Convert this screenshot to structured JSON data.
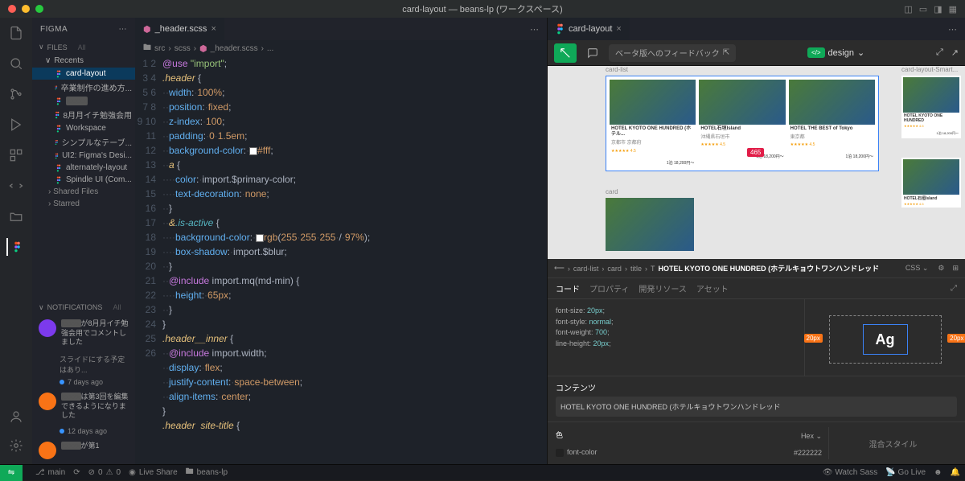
{
  "titlebar": {
    "title": "card-layout — beans-lp (ワークスペース)"
  },
  "sidebar": {
    "title": "FIGMA",
    "sections": {
      "files": "FILES",
      "all1": "All",
      "recents": "Recents",
      "items": [
        "card-layout",
        "卒業制作の進め方...",
        "",
        "8月月イチ勉強会用",
        "Workspace",
        "シンプルなテーブ...",
        "UI2: Figma's Desi...",
        "alternately-layout",
        "Spindle UI (Com..."
      ],
      "shared": "Shared Files",
      "starred": "Starred",
      "notifications": "NOTIFICATIONS",
      "all2": "All"
    },
    "notifs": [
      {
        "body_pre": "",
        "body": "が8月月イチ勉強会用でコメントしました",
        "meta": "スライドにする予定はあり...",
        "time": "7 days ago",
        "color": "#7c3aed"
      },
      {
        "body_pre": "",
        "body": "は第3回を編集できるようになりました",
        "meta": "",
        "time": "12 days ago",
        "color": "#f97316"
      },
      {
        "body_pre": "",
        "body": "が第1",
        "meta": "",
        "time": "",
        "color": "#f97316"
      }
    ]
  },
  "editor": {
    "tab": "_header.scss",
    "crumbs": [
      "src",
      "scss",
      "_header.scss",
      "..."
    ],
    "lines": [
      {
        "n": 1,
        "html": "<span class='k-use'>@use</span> <span class='k-str'>\"import\"</span><span class='k-pun'>;</span>"
      },
      {
        "n": 2,
        "html": "<span class='k-sel'>.header</span> <span class='k-pun'>{</span>"
      },
      {
        "n": 3,
        "html": "<span class='k-dot'>··</span><span class='k-prop'>width</span><span class='k-pun'>:</span><span class='k-dot'>·</span><span class='k-num'>100%</span><span class='k-pun'>;</span>"
      },
      {
        "n": 4,
        "html": "<span class='k-dot'>··</span><span class='k-prop'>position</span><span class='k-pun'>:</span><span class='k-dot'>·</span><span class='k-val'>fixed</span><span class='k-pun'>;</span>"
      },
      {
        "n": 5,
        "html": "<span class='k-dot'>··</span><span class='k-prop'>z-index</span><span class='k-pun'>:</span><span class='k-dot'>·</span><span class='k-num'>100</span><span class='k-pun'>;</span>"
      },
      {
        "n": 6,
        "html": "<span class='k-dot'>··</span><span class='k-prop'>padding</span><span class='k-pun'>:</span><span class='k-dot'>·</span><span class='k-num'>0</span><span class='k-dot'>·</span><span class='k-num'>1.5em</span><span class='k-pun'>;</span>"
      },
      {
        "n": 7,
        "html": "<span class='k-dot'>··</span><span class='k-prop'>background-color</span><span class='k-pun'>:</span><span class='k-dot'>·</span><span class='k-box'></span><span class='k-num'>#fff</span><span class='k-pun'>;</span>"
      },
      {
        "n": 8,
        "html": "<span class='k-dot'>··</span><span class='k-sel'>a</span> <span class='k-pun'>{</span>"
      },
      {
        "n": 9,
        "html": "<span class='k-dot'>····</span><span class='k-prop'>color</span><span class='k-pun'>:</span><span class='k-dot'>·</span>import.$primary-color<span class='k-pun'>;</span>"
      },
      {
        "n": 10,
        "html": "<span class='k-dot'>····</span><span class='k-prop'>text-decoration</span><span class='k-pun'>:</span><span class='k-dot'>·</span><span class='k-val'>none</span><span class='k-pun'>;</span>"
      },
      {
        "n": 11,
        "html": "<span class='k-dot'>··</span><span class='k-pun'>}</span>"
      },
      {
        "n": 12,
        "html": "<span class='k-dot'>··</span><span class='k-sel'>&amp;</span><span class='k-pse'>.is-active</span> <span class='k-pun'>{</span>"
      },
      {
        "n": 13,
        "html": "<span class='k-dot'>····</span><span class='k-prop'>background-color</span><span class='k-pun'>:</span><span class='k-dot'>·</span><span class='k-box'></span><span class='k-val'>rgb</span><span class='k-pun'>(</span><span class='k-num'>255</span><span class='k-dot'>·</span><span class='k-num'>255</span><span class='k-dot'>·</span><span class='k-num'>255</span><span class='k-dot'>·</span><span class='k-pun'>/</span><span class='k-dot'>·</span><span class='k-num'>97%</span><span class='k-pun'>);</span>"
      },
      {
        "n": 14,
        "html": "<span class='k-dot'>····</span><span class='k-prop'>box-shadow</span><span class='k-pun'>:</span><span class='k-dot'>·</span>import.$blur<span class='k-pun'>;</span>"
      },
      {
        "n": 15,
        "html": "<span class='k-dot'>··</span><span class='k-pun'>}</span>"
      },
      {
        "n": 16,
        "html": "<span class='k-dot'>··</span><span class='k-use'>@include</span> import.mq(md-min) <span class='k-pun'>{</span>"
      },
      {
        "n": 17,
        "html": "<span class='k-dot'>····</span><span class='k-prop'>height</span><span class='k-pun'>:</span><span class='k-dot'>·</span><span class='k-num'>65px</span><span class='k-pun'>;</span>"
      },
      {
        "n": 18,
        "html": "<span class='k-dot'>··</span><span class='k-pun'>}</span>"
      },
      {
        "n": 19,
        "html": "<span class='k-pun'>}</span>"
      },
      {
        "n": 20,
        "html": "<span class='k-sel'>.header__inner</span> <span class='k-pun'>{</span>"
      },
      {
        "n": 21,
        "html": "<span class='k-dot'>··</span><span class='k-use'>@include</span> import.width<span class='k-pun'>;</span>"
      },
      {
        "n": 22,
        "html": "<span class='k-dot'>··</span><span class='k-prop'>display</span><span class='k-pun'>:</span><span class='k-dot'>·</span><span class='k-val'>flex</span><span class='k-pun'>;</span>"
      },
      {
        "n": 23,
        "html": "<span class='k-dot'>··</span><span class='k-prop'>justify-content</span><span class='k-pun'>:</span><span class='k-dot'>·</span><span class='k-val'>space-between</span><span class='k-pun'>;</span>"
      },
      {
        "n": 24,
        "html": "<span class='k-dot'>··</span><span class='k-prop'>align-items</span><span class='k-pun'>:</span><span class='k-dot'>·</span><span class='k-val'>center</span><span class='k-pun'>;</span>"
      },
      {
        "n": 25,
        "html": "<span class='k-pun'>}</span>"
      },
      {
        "n": 26,
        "html": "<span class='k-sel'>.header</span>  <span class='k-sel'>site-title</span> <span class='k-pun'>{</span>"
      }
    ]
  },
  "figma": {
    "tab": "card-layout",
    "feedback": "ベータ版へのフィードバック",
    "design": "design",
    "frame_labels": {
      "list": "card-list",
      "card": "card",
      "smart": "card-layout-Smart..."
    },
    "cards": [
      {
        "title": "HOTEL KYOTO ONE HUNDRED (ホテル...",
        "sub": "京都市 京都府",
        "price": "1泊 18,200円〜"
      },
      {
        "title": "HOTEL石垣Island",
        "sub": "沖縄県石垣市",
        "price": "1泊 18,200円〜"
      },
      {
        "title": "HOTEL THE BEST of Tokyo",
        "sub": "東京都",
        "price": "1泊 18,200円〜"
      }
    ],
    "sel_badge": "465",
    "inspector": {
      "crumbs": [
        "card-list",
        "card",
        "title"
      ],
      "title": "HOTEL KYOTO ONE HUNDRED (ホテルキョウトワンハンドレッド",
      "css_label": "CSS",
      "tabs": [
        "コード",
        "プロパティ",
        "開発リソース",
        "アセット"
      ],
      "css": [
        "font-size: 20px;",
        "font-style: normal;",
        "font-weight: 700;",
        "line-height: 20px;"
      ],
      "box_px": "20px",
      "ag": "Ag",
      "content_h": "コンテンツ",
      "content": "HOTEL KYOTO ONE HUNDRED (ホテルキョウトワンハンドレッド",
      "color_h": "色",
      "hex": "Hex",
      "color_name": "font-color",
      "color_val": "#222222",
      "mixed": "混合スタイル"
    }
  },
  "statusbar": {
    "branch": "main",
    "sync": "⟳",
    "err": "0",
    "warn": "0",
    "liveshare": "Live Share",
    "folder": "beans-lp",
    "watch": "Watch Sass",
    "golive": "Go Live"
  }
}
